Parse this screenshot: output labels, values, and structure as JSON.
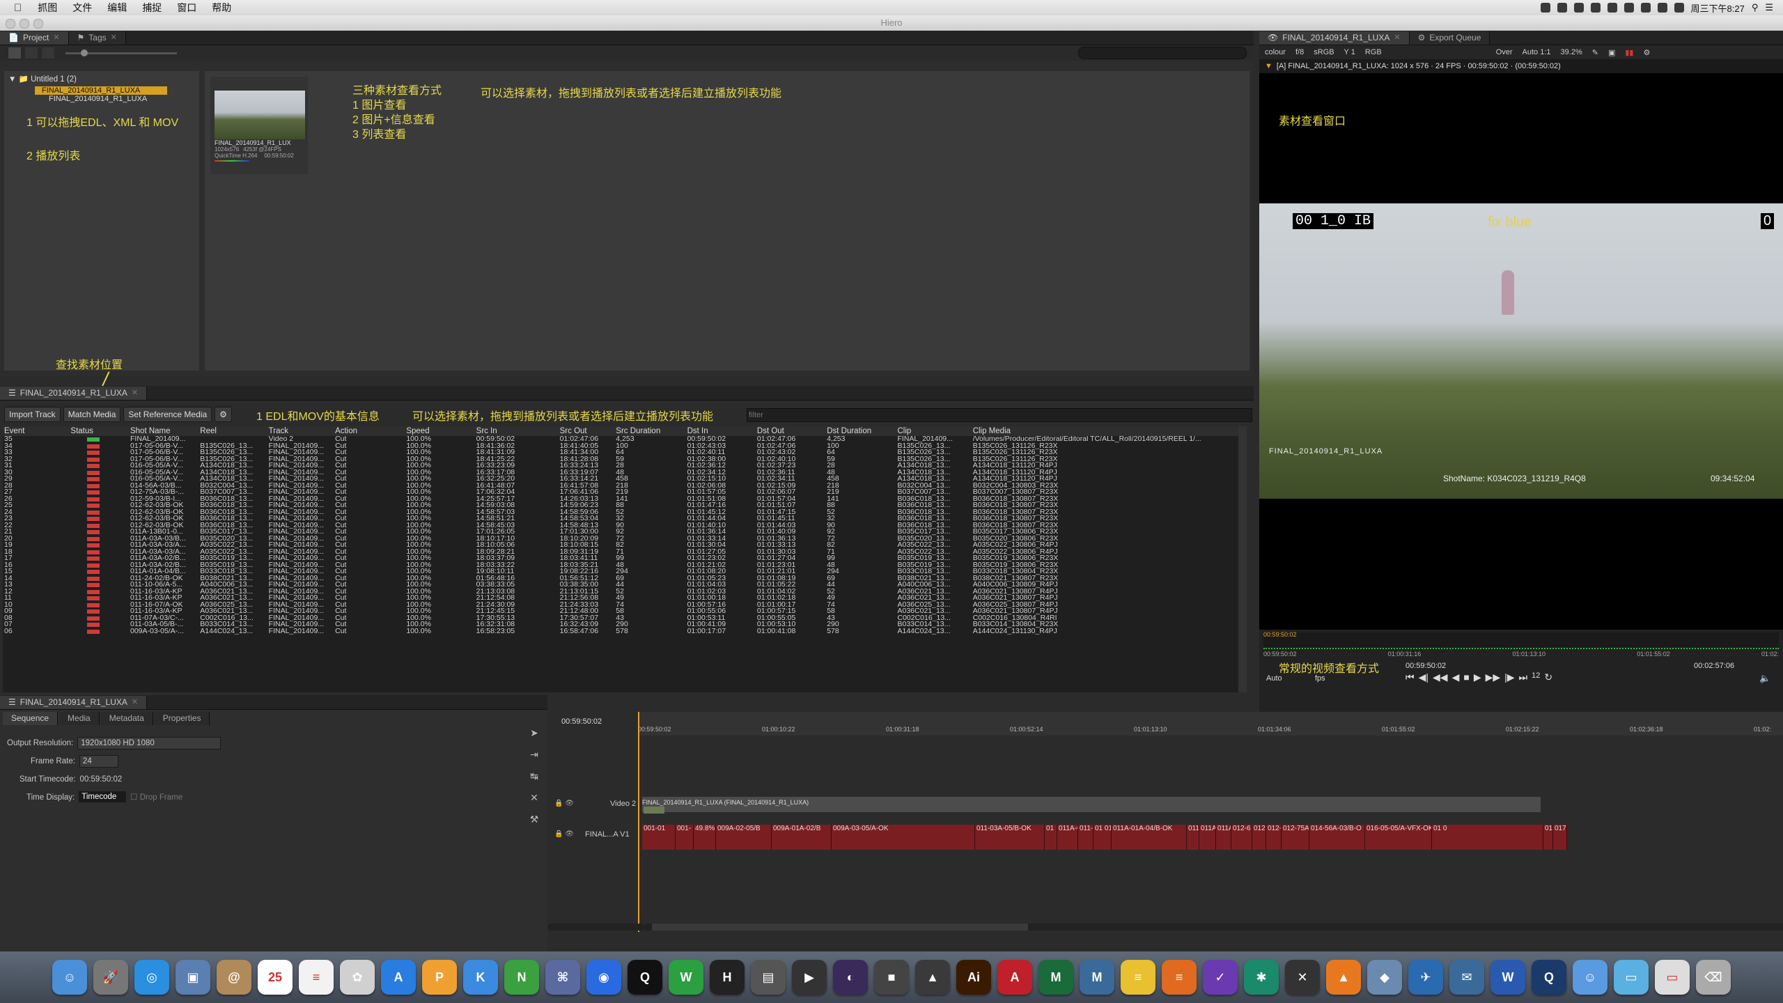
{
  "menubar": {
    "apple": "",
    "items": [
      "抓图",
      "文件",
      "编辑",
      "捕捉",
      "窗口",
      "帮助"
    ],
    "clock": "周三下午8:27"
  },
  "window": {
    "title": "Hiero"
  },
  "project": {
    "tabs": [
      {
        "label": "Project"
      },
      {
        "label": "Tags"
      }
    ],
    "tree": {
      "root": "Untitled 1 (2)",
      "items": [
        "FINAL_20140914_R1_LUXA",
        "FINAL_20140914_R1_LUXA"
      ]
    },
    "notes": {
      "a": "1 可以拖拽EDL、XML 和 MOV",
      "b": "2 播放列表"
    },
    "thumb": {
      "name": "FINAL_20140914_R1_LUX",
      "meta1": "1024x576",
      "meta2": "4253f @24FPS",
      "meta3": "QuickTime H.264",
      "tc": "00:59:50:02"
    },
    "view_modes": {
      "title": "三种素材查看方式",
      "m1": "1 图片查看",
      "m2": "2 图片+信息查看",
      "m3": "3 列表查看"
    },
    "side_note": "可以选择素材，拖拽到播放列表或者选择后建立播放列表功能"
  },
  "seqpane": {
    "tab": "FINAL_20140914_R1_LUXA",
    "find_note": "查找素材位置",
    "buttons": {
      "import": "Import Track",
      "match": "Match Media",
      "setref": "Set Reference Media"
    },
    "filter_placeholder": "filter",
    "info_note1": "1 EDL和MOV的基本信息",
    "info_note2": "可以选择素材，拖拽到播放列表或者选择后建立播放列表功能",
    "columns": [
      "Event",
      "Status",
      "Shot Name",
      "Reel",
      "Track",
      "Action",
      "Speed",
      "Src In",
      "Src Out",
      "Src Duration",
      "Dst In",
      "Dst Out",
      "Dst Duration",
      "Clip",
      "Clip Media"
    ],
    "rows": [
      [
        "35",
        "g",
        "FINAL_201409...",
        "",
        "Video 2",
        "Cut",
        "100.0%",
        "00:59:50:02",
        "01:02:47:06",
        "4,253",
        "00:59:50:02",
        "01:02:47:06",
        "4,253",
        "FINAL_201409...",
        "/Volumes/Producer/Editoral/Editoral TC/ALL_Roll/20140915/REEL 1/..."
      ],
      [
        "34",
        "r",
        "017-05-06/B-V...",
        "B135C026_13...",
        "FINAL_201409...",
        "Cut",
        "100.0%",
        "18:41:36:02",
        "18:41:40:05",
        "100",
        "01:02:43:03",
        "01:02:47:06",
        "100",
        "B135C026_13...",
        "B135C026_131126_R23X"
      ],
      [
        "33",
        "r",
        "017-05-06/B-V...",
        "B135C026_13...",
        "FINAL_201409...",
        "Cut",
        "100.0%",
        "18:41:31:09",
        "18:41:34:00",
        "64",
        "01:02:40:11",
        "01:02:43:02",
        "64",
        "B135C026_13...",
        "B135C026_131126_R23X"
      ],
      [
        "32",
        "r",
        "017-05-06/B-V...",
        "B135C026_13...",
        "FINAL_201409...",
        "Cut",
        "100.0%",
        "18:41:25:22",
        "18:41:28:08",
        "59",
        "01:02:38:00",
        "01:02:40:10",
        "59",
        "B135C026_13...",
        "B135C026_131126_R23X"
      ],
      [
        "31",
        "r",
        "016-05-05/A-V...",
        "A134C018_13...",
        "FINAL_201409...",
        "Cut",
        "100.0%",
        "16:33:23:09",
        "16:33:24:13",
        "28",
        "01:02:36:12",
        "01:02:37:23",
        "28",
        "A134C018_13...",
        "A134C018_131120_R4PJ"
      ],
      [
        "30",
        "r",
        "016-05-05/A-V...",
        "A134C018_13...",
        "FINAL_201409...",
        "Cut",
        "100.0%",
        "16:33:17:08",
        "16:33:19:07",
        "48",
        "01:02:34:12",
        "01:02:36:11",
        "48",
        "A134C018_13...",
        "A134C018_131120_R4PJ"
      ],
      [
        "29",
        "r",
        "016-05-05/A-V...",
        "A134C018_13...",
        "FINAL_201409...",
        "Cut",
        "100.0%",
        "16:32:25:20",
        "16:33:14:21",
        "458",
        "01:02:15:10",
        "01:02:34:11",
        "458",
        "A134C018_13...",
        "A134C018_131120_R4PJ"
      ],
      [
        "28",
        "r",
        "014-56A-03/B...",
        "B032C004_13...",
        "FINAL_201409...",
        "Cut",
        "100.0%",
        "16:41:48:07",
        "16:41:57:08",
        "218",
        "01:02:06:08",
        "01:02:15:09",
        "218",
        "B032C004_13...",
        "B032C004_130803_R23X"
      ],
      [
        "27",
        "r",
        "012-75A-03/B-...",
        "B037C007_13...",
        "FINAL_201409...",
        "Cut",
        "100.0%",
        "17:06:32:04",
        "17:06:41:06",
        "219",
        "01:01:57:05",
        "01:02:06:07",
        "219",
        "B037C007_13...",
        "B037C007_130807_R23X"
      ],
      [
        "26",
        "r",
        "012-59-03/B-I...",
        "B036C018_13...",
        "FINAL_201409...",
        "Cut",
        "100.0%",
        "14:25:57:17",
        "14:26:03:13",
        "141",
        "01:01:51:08",
        "01:01:57:04",
        "141",
        "B036C018_13...",
        "B036C018_130807_R23X"
      ],
      [
        "25",
        "r",
        "012-62-03/B-OK",
        "B036C018_13...",
        "FINAL_201409...",
        "Cut",
        "100.0%",
        "14:59:03:08",
        "14:59:06:23",
        "88",
        "01:01:47:16",
        "01:01:51:07",
        "88",
        "B036C018_13...",
        "B036C018_130807_R23X"
      ],
      [
        "24",
        "r",
        "012-62-03/B-OK",
        "B036C018_13...",
        "FINAL_201409...",
        "Cut",
        "100.0%",
        "14:58:57:03",
        "14:58:59:06",
        "52",
        "01:01:45:12",
        "01:01:47:15",
        "52",
        "B036C018_13...",
        "B036C018_130807_R23X"
      ],
      [
        "23",
        "r",
        "012-62-03/B-OK",
        "B036C018_13...",
        "FINAL_201409...",
        "Cut",
        "100.0%",
        "14:58:51:21",
        "14:58:53:04",
        "32",
        "01:01:44:04",
        "01:01:45:11",
        "32",
        "B036C018_13...",
        "B036C018_130807_R23X"
      ],
      [
        "22",
        "r",
        "012-62-03/B-OK",
        "B036C018_13...",
        "FINAL_201409...",
        "Cut",
        "100.0%",
        "14:58:45:03",
        "14:58:48:13",
        "90",
        "01:01:40:10",
        "01:01:44:03",
        "90",
        "B036C018_13...",
        "B036C018_130807_R23X"
      ],
      [
        "21",
        "r",
        "011A-13B01-0...",
        "B035C017_13...",
        "FINAL_201409...",
        "Cut",
        "100.0%",
        "17:01:26:05",
        "17:01:30:00",
        "92",
        "01:01:36:14",
        "01:01:40:09",
        "92",
        "B035C017_13...",
        "B035C017_130806_R23X"
      ],
      [
        "20",
        "r",
        "011A-03A-03/B...",
        "B035C020_13...",
        "FINAL_201409...",
        "Cut",
        "100.0%",
        "18:10:17:10",
        "18:10:20:09",
        "72",
        "01:01:33:14",
        "01:01:36:13",
        "72",
        "B035C020_13...",
        "B035C020_130806_R23X"
      ],
      [
        "19",
        "r",
        "011A-03A-03/A...",
        "A035C022_13...",
        "FINAL_201409...",
        "Cut",
        "100.0%",
        "18:10:05:06",
        "18:10:08:15",
        "82",
        "01:01:30:04",
        "01:01:33:13",
        "82",
        "A035C022_13...",
        "A035C022_130806_R4PJ"
      ],
      [
        "18",
        "r",
        "011A-03A-03/A...",
        "A035C022_13...",
        "FINAL_201409...",
        "Cut",
        "100.0%",
        "18:09:28:21",
        "18:09:31:19",
        "71",
        "01:01:27:05",
        "01:01:30:03",
        "71",
        "A035C022_13...",
        "A035C022_130806_R4PJ"
      ],
      [
        "17",
        "r",
        "011A-03A-02/B...",
        "B035C019_13...",
        "FINAL_201409...",
        "Cut",
        "100.0%",
        "18:03:37:09",
        "18:03:41:11",
        "99",
        "01:01:23:02",
        "01:01:27:04",
        "99",
        "B035C019_13...",
        "B035C019_130806_R23X"
      ],
      [
        "16",
        "r",
        "011A-03A-02/B...",
        "B035C019_13...",
        "FINAL_201409...",
        "Cut",
        "100.0%",
        "18:03:33:22",
        "18:03:35:21",
        "48",
        "01:01:21:02",
        "01:01:23:01",
        "48",
        "B035C019_13...",
        "B035C019_130806_R23X"
      ],
      [
        "15",
        "r",
        "011A-01A-04/B...",
        "B033C018_13...",
        "FINAL_201409...",
        "Cut",
        "100.0%",
        "19:08:10:11",
        "19:08:22:16",
        "294",
        "01:01:08:20",
        "01:01:21:01",
        "294",
        "B033C018_13...",
        "B033C018_130804_R23X"
      ],
      [
        "14",
        "r",
        "011-24-02/B-OK",
        "B038C021_13...",
        "FINAL_201409...",
        "Cut",
        "100.0%",
        "01:56:48:16",
        "01:56:51:12",
        "69",
        "01:01:05:23",
        "01:01:08:19",
        "69",
        "B038C021_13...",
        "B038C021_130807_R23X"
      ],
      [
        "13",
        "r",
        "011-10-06/A-5...",
        "A040C006_13...",
        "FINAL_201409...",
        "Cut",
        "100.0%",
        "03:38:33:05",
        "03:38:35:00",
        "44",
        "01:01:04:03",
        "01:01:05:22",
        "44",
        "A040C006_13...",
        "A040C006_130809_R4PJ"
      ],
      [
        "12",
        "r",
        "011-16-03/A-KP",
        "A036C021_13...",
        "FINAL_201409...",
        "Cut",
        "100.0%",
        "21:13:03:08",
        "21:13:01:15",
        "52",
        "01:01:02:03",
        "01:01:04:02",
        "52",
        "A036C021_13...",
        "A036C021_130807_R4PJ"
      ],
      [
        "11",
        "r",
        "011-16-03/A-KP",
        "A036C021_13...",
        "FINAL_201409...",
        "Cut",
        "100.0%",
        "21:12:54:08",
        "21:12:56:08",
        "49",
        "01:01:00:18",
        "01:01:02:18",
        "49",
        "A036C021_13...",
        "A036C021_130807_R4PJ"
      ],
      [
        "10",
        "r",
        "011-16-07/A-OK",
        "A036C025_13...",
        "FINAL_201409...",
        "Cut",
        "100.0%",
        "21:24:30:09",
        "21:24:33:03",
        "74",
        "01:00:57:16",
        "01:01:00:17",
        "74",
        "A036C025_13...",
        "A036C025_130807_R4PJ"
      ],
      [
        "09",
        "r",
        "011-16-03/A-KP",
        "A036C021_13...",
        "FINAL_201409...",
        "Cut",
        "100.0%",
        "21:12:45:15",
        "21:12:48:00",
        "58",
        "01:00:55:06",
        "01:00:57:15",
        "58",
        "A036C021_13...",
        "A036C021_130807_R4PJ"
      ],
      [
        "08",
        "r",
        "011-07A-03/C-...",
        "C002C016_13...",
        "FINAL_201409...",
        "Cut",
        "100.0%",
        "17:30:55:13",
        "17:30:57:07",
        "43",
        "01:00:53:11",
        "01:00:55:05",
        "43",
        "C002C016_13...",
        "C002C016_130804_R4RI"
      ],
      [
        "07",
        "r",
        "011-03A-05/B-...",
        "B033C014_13...",
        "FINAL_201409...",
        "Cut",
        "100.0%",
        "16:32:31:08",
        "16:32:43:09",
        "290",
        "01:00:41:09",
        "01:00:53:10",
        "290",
        "B033C014_13...",
        "B033C014_130804_R23X"
      ],
      [
        "06",
        "r",
        "009A-03-05/A-...",
        "A144C024_13...",
        "FINAL_201409...",
        "Cut",
        "100.0%",
        "16:58:23:05",
        "16:58:47:06",
        "578",
        "01:00:17:07",
        "01:00:41:08",
        "578",
        "A144C024_13...",
        "A144C024_131130_R4PJ"
      ]
    ]
  },
  "viewer": {
    "tabs": [
      {
        "label": "FINAL_20140914_R1_LUXA"
      },
      {
        "label": "Export Queue"
      }
    ],
    "toolbar": {
      "colour": "colour",
      "fstop": "f/8",
      "lut": "sRGB",
      "y": "Y 1",
      "rgb": "RGB",
      "over": "Over",
      "auto": "Auto 1:1",
      "zoom": "39.2%"
    },
    "info": "[A] FINAL_20140914_R1_LUXA: 1024 x 576 · 24 FPS · 00:59:50:02 · (00:59:50:02)",
    "note": "素材查看窗口",
    "burnin_tl": "00 1_0 IB",
    "burnin_center": "fix blue",
    "burnin_tr": "0",
    "burnin_bl": "FINAL_20140914_R1_LUXA",
    "burnin_shot": "ShotName: K034C023_131219_R4Q8",
    "burnin_tc": "09:34:52:04",
    "scrub_in": "00:59:50:02",
    "ruler": [
      "00:59:50:02",
      "01:00:31:16",
      "01:01:13:10",
      "01:01:55:02",
      "01:02:"
    ],
    "bottom_note": "常规的视频查看方式",
    "tc_current": "00:59:50:02",
    "tc_end": "00:02:57:06",
    "auto": "Auto",
    "fps": "fps",
    "frame_step": "12"
  },
  "props": {
    "tab": "FINAL_20140914_R1_LUXA",
    "subtabs": [
      "Sequence",
      "Media",
      "Metadata",
      "Properties"
    ],
    "output_label": "Output Resolution:",
    "output_value": "1920x1080 HD 1080",
    "framerate_label": "Frame Rate:",
    "framerate_value": "24",
    "starttc_label": "Start Timecode:",
    "starttc_value": "00:59:50:02",
    "timedisp_label": "Time Display:",
    "timedisp_value": "Timecode",
    "dropframe": "Drop Frame"
  },
  "timeline": {
    "current_tc": "00:59:50:02",
    "ruler": [
      "00:59:50:02",
      "01:00:10:22",
      "01:00:31:18",
      "01:00:52:14",
      "01:01:13:10",
      "01:01:34:06",
      "01:01:55:02",
      "01:02:15:22",
      "01:02:36:18",
      "01:02:"
    ],
    "track_v2": "Video 2",
    "track_v1": "FINAL...A V1",
    "v2_clip": "FINAL_20140914_R1_LUXA (FINAL_20140914_R1_LUXA)",
    "v1_clips": [
      "001-01",
      "001-",
      "49.8%",
      "009A-02-05/B",
      "009A-01A-02/B",
      "009A-03-05/A-OK",
      "011-03A-05/B-OK",
      "01",
      "011A-0",
      "011-",
      "01 01",
      "011A-01A-04/B-OK",
      "011A-0",
      "011A-",
      "011A-",
      "012-6",
      "012-",
      "012-59-03",
      "012-75A-03/B-O",
      "014-56A-03/B-O",
      "016-05-05/A-VFX-OK",
      "01 0",
      "017",
      "017-05"
    ]
  },
  "dock": {
    "calendar_month": "8月",
    "calendar_day": "25"
  },
  "colors": {
    "accent": "#d6a020",
    "note": "#e6d84a",
    "clip": "#7a1e22",
    "status_green": "#3bb54a",
    "status_red": "#d23a3a"
  }
}
